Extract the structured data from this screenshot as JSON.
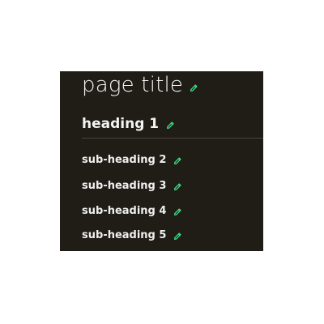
{
  "colors": {
    "panel_background": "#201d16",
    "text": "#f2f2f2",
    "edit_icon": "#3ddc84",
    "divider": "#4a463d"
  },
  "page_title": {
    "text": "page title",
    "edit_icon": "pencil-icon"
  },
  "heading_1": {
    "text": "heading 1",
    "edit_icon": "pencil-icon"
  },
  "sub_headings": [
    {
      "text": "sub-heading 2",
      "edit_icon": "pencil-icon"
    },
    {
      "text": "sub-heading 3",
      "edit_icon": "pencil-icon"
    },
    {
      "text": "sub-heading 4",
      "edit_icon": "pencil-icon"
    },
    {
      "text": "sub-heading 5",
      "edit_icon": "pencil-icon"
    }
  ]
}
